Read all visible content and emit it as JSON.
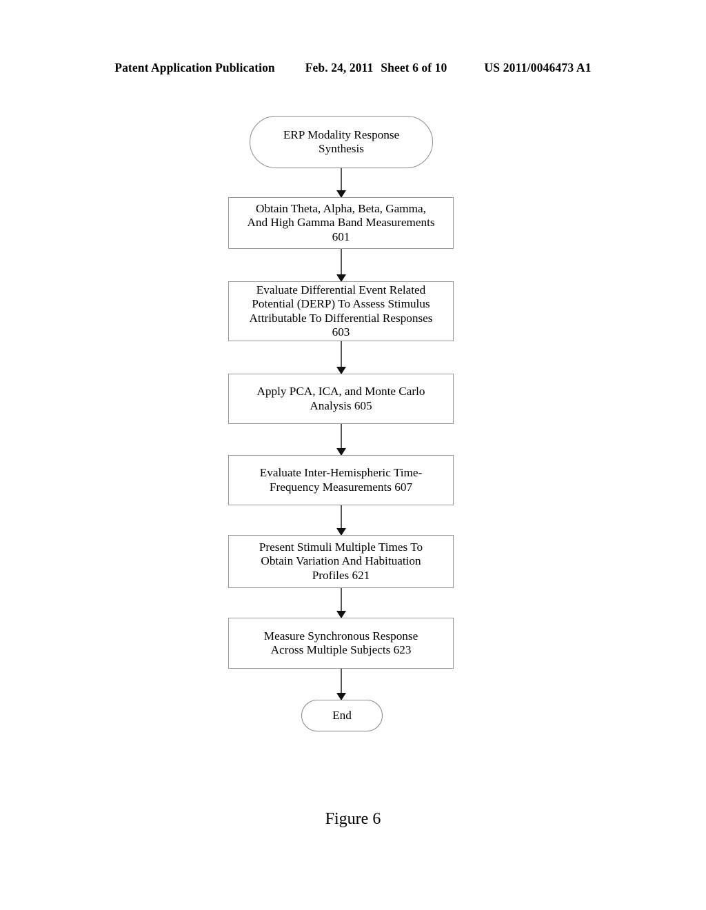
{
  "page": {
    "header": {
      "publication": "Patent Application Publication",
      "date": "Feb. 24, 2011",
      "sheet": "Sheet 6 of 10",
      "patent_number": "US 2011/0046473 A1"
    },
    "caption": "Figure 6",
    "background_color": "#ffffff",
    "ink_color": "#000000"
  },
  "flowchart": {
    "title": "ERP Modality Response Synthesis flow",
    "nodes": [
      {
        "id": "start",
        "shape": "terminator",
        "label": "ERP Modality Response\nSynthesis",
        "ref": ""
      },
      {
        "id": "601",
        "shape": "process",
        "label": "Obtain Theta, Alpha, Beta, Gamma,\nAnd High Gamma Band Measurements\n601",
        "ref": "601"
      },
      {
        "id": "603",
        "shape": "process",
        "label": "Evaluate Differential Event Related\nPotential (DERP) To Assess Stimulus\nAttributable To Differential Responses\n603",
        "ref": "603"
      },
      {
        "id": "605",
        "shape": "process",
        "label": "Apply PCA, ICA, and Monte Carlo\nAnalysis 605",
        "ref": "605"
      },
      {
        "id": "607",
        "shape": "process",
        "label": "Evaluate Inter-Hemispheric Time-\nFrequency Measurements 607",
        "ref": "607"
      },
      {
        "id": "621",
        "shape": "process",
        "label": "Present Stimuli Multiple Times To\nObtain Variation And Habituation\nProfiles 621",
        "ref": "621"
      },
      {
        "id": "623",
        "shape": "process",
        "label": "Measure Synchronous Response\nAcross Multiple Subjects 623",
        "ref": "623"
      },
      {
        "id": "end",
        "shape": "terminator",
        "label": "End",
        "ref": ""
      }
    ],
    "connectors": [
      {
        "from": "start",
        "to": "601",
        "arrow": "down-arrow-icon"
      },
      {
        "from": "601",
        "to": "603",
        "arrow": "down-arrow-icon"
      },
      {
        "from": "603",
        "to": "605",
        "arrow": "down-arrow-icon"
      },
      {
        "from": "605",
        "to": "607",
        "arrow": "down-arrow-icon"
      },
      {
        "from": "607",
        "to": "621",
        "arrow": "down-arrow-icon"
      },
      {
        "from": "621",
        "to": "623",
        "arrow": "down-arrow-icon"
      },
      {
        "from": "623",
        "to": "end",
        "arrow": "down-arrow-icon"
      }
    ]
  }
}
